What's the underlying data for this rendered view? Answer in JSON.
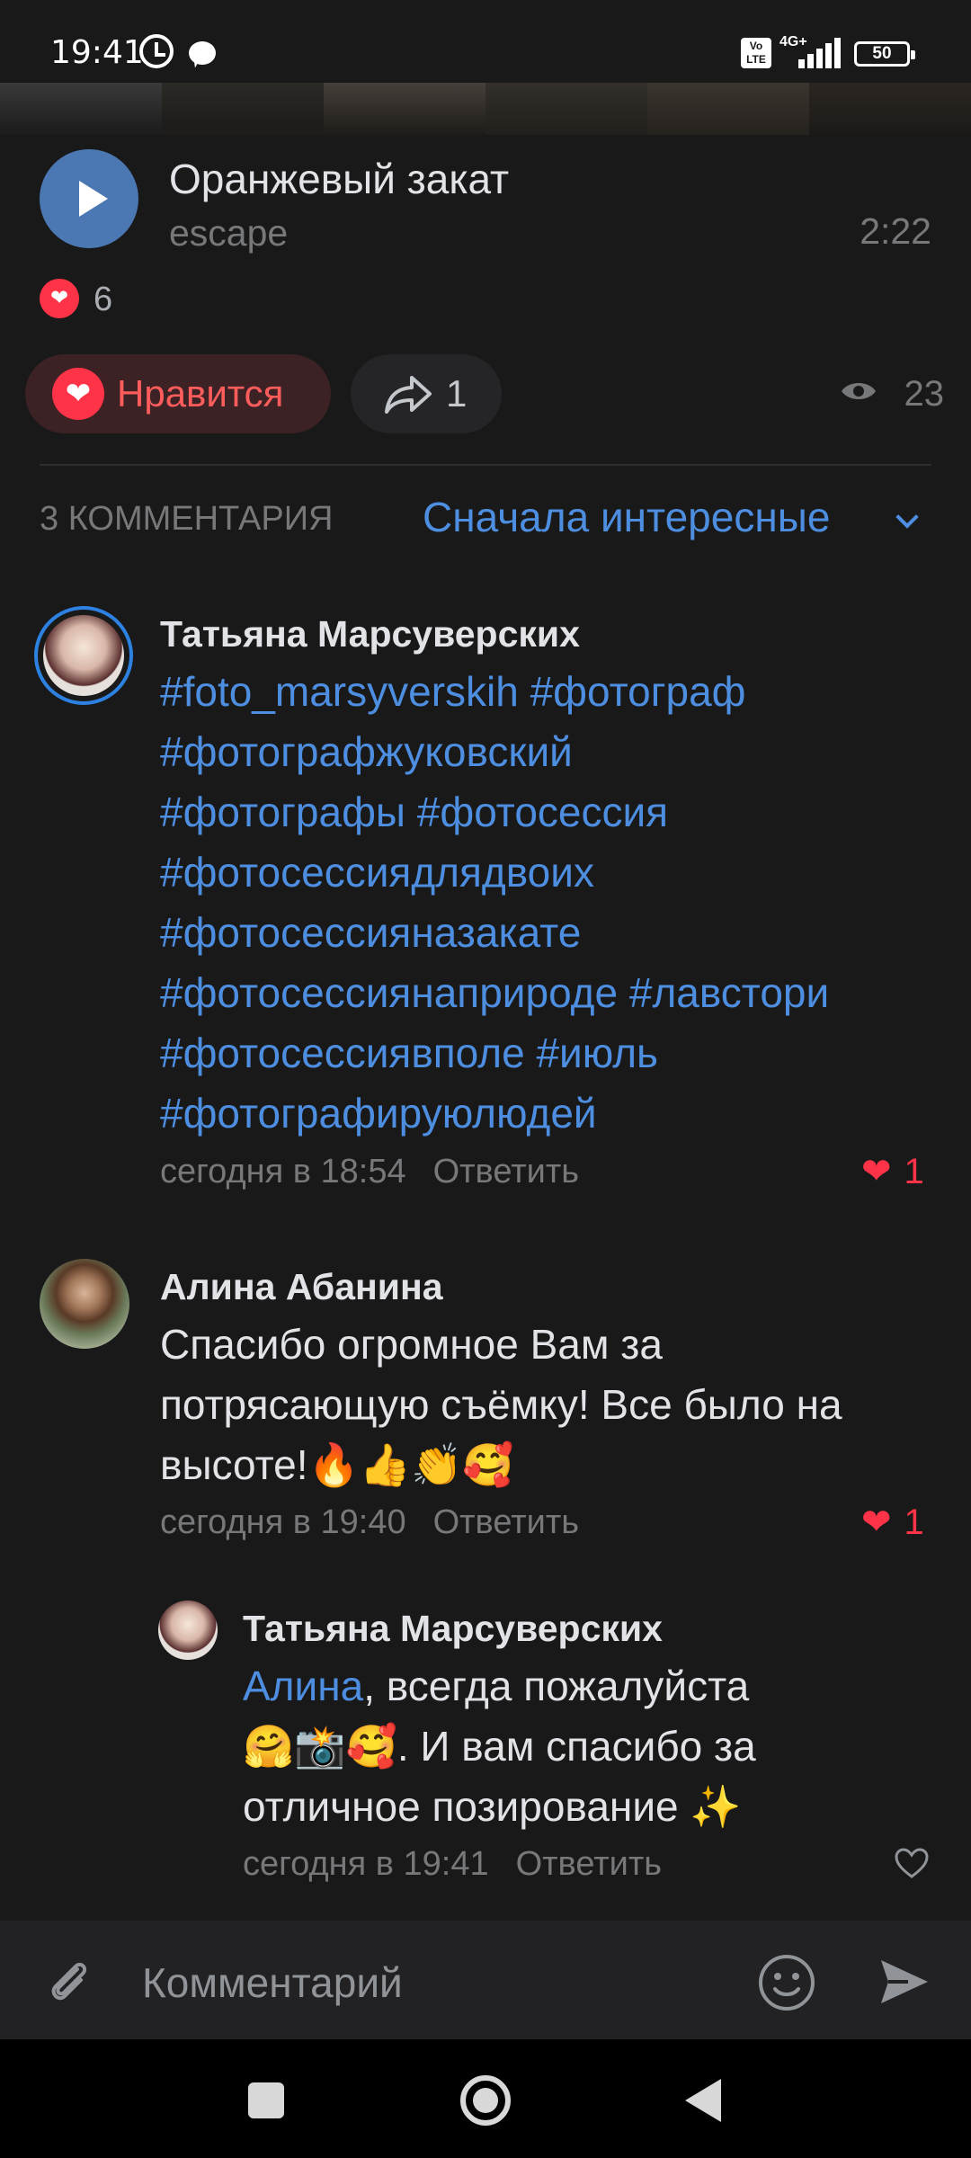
{
  "status_bar": {
    "time": "19:41",
    "network": "4G+",
    "volte": "Vo LTE",
    "battery": "50"
  },
  "audio": {
    "title": "Оранжевый закат",
    "artist": "escape",
    "duration": "2:22"
  },
  "reactions": {
    "count": "6"
  },
  "actions": {
    "like_label": "Нравится",
    "share_count": "1",
    "views_count": "23"
  },
  "comments_header": {
    "count_label": "3 КОММЕНТАРИЯ",
    "sort_label": "Сначала интересные"
  },
  "comments": [
    {
      "author": "Татьяна Марсуверских",
      "lines": [
        "#foto_marsyverskih #фотограф",
        "#фотографжуковский",
        "#фотографы #фотосессия",
        "#фотосессиядлядвоих",
        "#фотосессияназакате",
        "#фотосессиянаприроде #лавстори",
        "#фотосессиявполе #июль",
        "#фотографируюлюдей"
      ],
      "time": "сегодня в 18:54",
      "reply_label": "Ответить",
      "likes": "1"
    },
    {
      "author": "Алина Абанина",
      "lines": [
        "Спасибо огромное Вам за",
        "потрясающую съёмку! Все было на",
        "высоте!🔥👍👏🥰"
      ],
      "time": "сегодня в 19:40",
      "reply_label": "Ответить",
      "likes": "1"
    },
    {
      "author": "Татьяна Марсуверских",
      "mention": "Алина",
      "line1_rest": ", всегда пожалуйста",
      "line2": "🤗📸🥰. И вам спасибо за",
      "line3": "отличное позирование ✨",
      "time": "сегодня в 19:41",
      "reply_label": "Ответить"
    }
  ],
  "composer": {
    "placeholder": "Комментарий"
  },
  "colors": {
    "background": "#19191a",
    "accent_blue": "#4d8ee0",
    "like_red": "#ff3347",
    "secondary_text": "#76787a"
  }
}
